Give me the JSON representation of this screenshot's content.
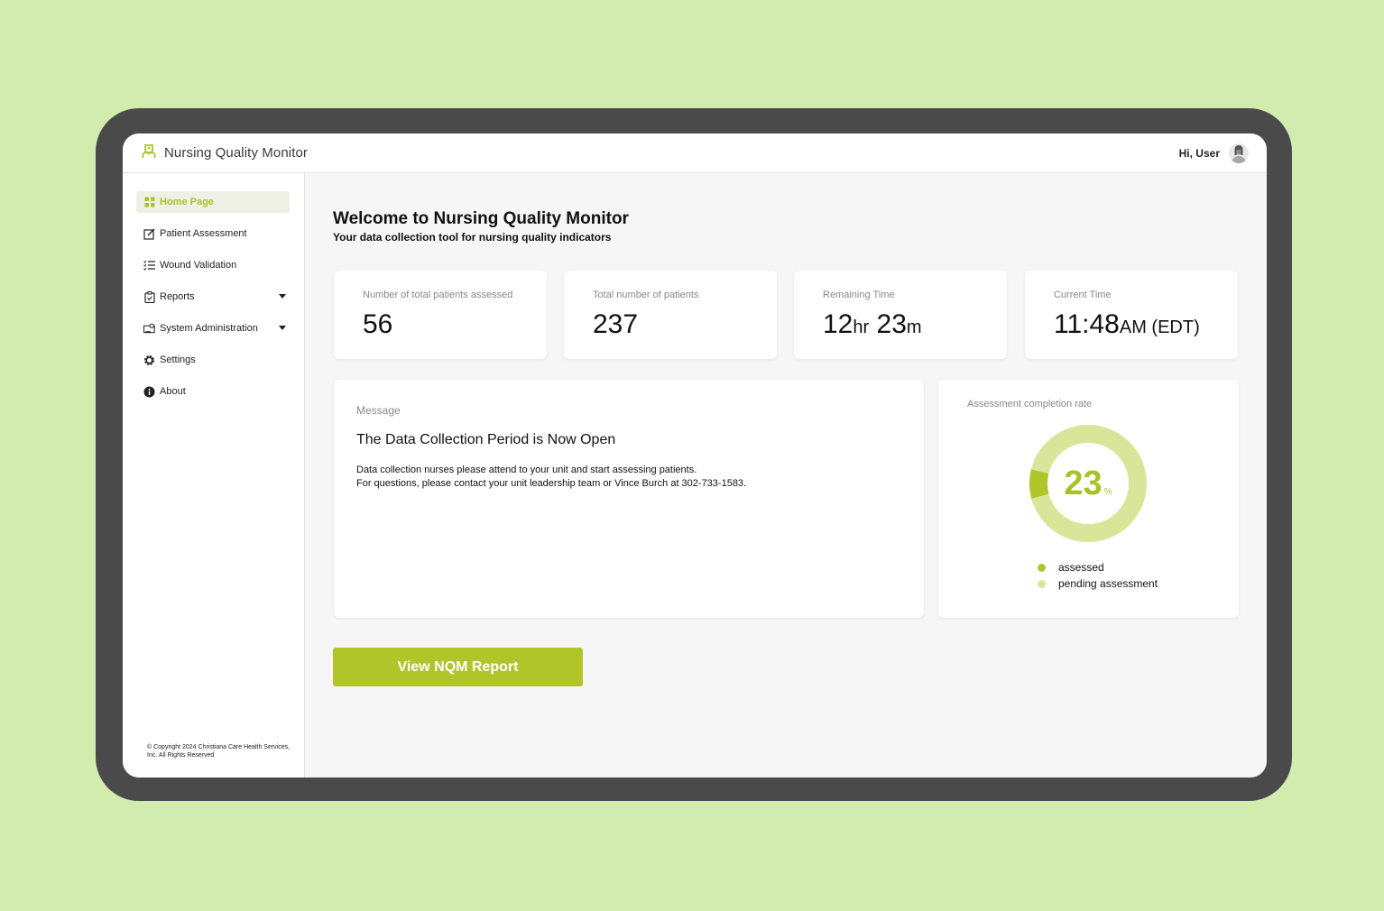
{
  "app": {
    "title": "Nursing Quality Monitor"
  },
  "user": {
    "greeting": "Hi, User"
  },
  "colors": {
    "accent": "#b0c529",
    "accent_light": "#d9e69a",
    "active_bg": "#eef0e6"
  },
  "sidebar": {
    "items": [
      {
        "label": "Home Page",
        "icon": "grid-icon",
        "active": true
      },
      {
        "label": "Patient Assessment",
        "icon": "edit-icon"
      },
      {
        "label": "Wound Validation",
        "icon": "checklist-icon"
      },
      {
        "label": "Reports",
        "icon": "clipboard-icon",
        "expandable": true
      },
      {
        "label": "System Administration",
        "icon": "admin-icon",
        "expandable": true
      },
      {
        "label": "Settings",
        "icon": "gear-icon"
      },
      {
        "label": "About",
        "icon": "info-icon"
      }
    ],
    "copyright": "© Copyright 2024 Christiana Care Health Services, Inc. All Rights Reserved"
  },
  "welcome": {
    "title": "Welcome to Nursing Quality Monitor",
    "subtitle": "Your data collection tool for nursing quality indicators"
  },
  "stats": {
    "assessed": {
      "label": "Number of total patients assessed",
      "value": "56"
    },
    "total": {
      "label": "Total number of patients",
      "value": "237"
    },
    "remaining": {
      "label": "Remaining Time",
      "hours": "12",
      "hours_unit": "hr",
      "minutes": "23",
      "minutes_unit": "m"
    },
    "current": {
      "label": "Current Time",
      "time": "11:48",
      "suffix": "AM (EDT)"
    }
  },
  "message": {
    "label": "Message",
    "heading": "The Data Collection Period is Now Open",
    "line1": "Data collection nurses please attend to your unit and start assessing patients.",
    "line2": "For questions, please contact your unit leadership team or Vince Burch at 302-733-1583."
  },
  "completion": {
    "label": "Assessment completion rate",
    "percent": 23,
    "percent_text": "23",
    "percent_sign": "%",
    "legend": {
      "assessed": "assessed",
      "pending": "pending assessment"
    }
  },
  "actions": {
    "report_button": "View NQM Report"
  }
}
